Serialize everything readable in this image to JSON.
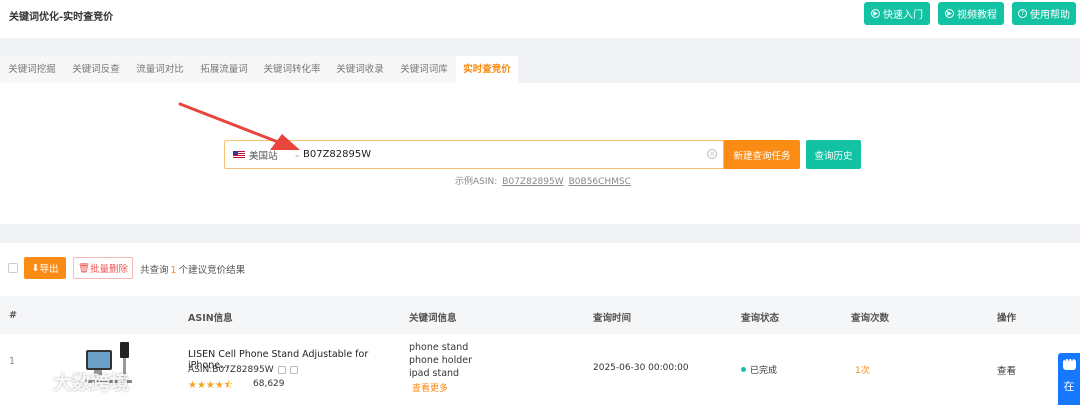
{
  "header": {
    "title": "关键词优化-实时查竞价",
    "buttons": [
      {
        "label": "快速入门",
        "icon": "play-circle-icon"
      },
      {
        "label": "视频教程",
        "icon": "play-circle-icon"
      },
      {
        "label": "使用帮助",
        "icon": "question-circle-icon"
      }
    ]
  },
  "tabs": [
    {
      "label": "关键词挖掘"
    },
    {
      "label": "关键词反查"
    },
    {
      "label": "流量词对比"
    },
    {
      "label": "拓展流量词"
    },
    {
      "label": "关键词转化率"
    },
    {
      "label": "关键词收录"
    },
    {
      "label": "关键词词库"
    },
    {
      "label": "实时查竞价",
      "active": true
    }
  ],
  "search": {
    "site": "美国站",
    "value": "B07Z82895W",
    "new_task_label": "新建查询任务",
    "history_label": "查询历史",
    "example_prefix": "示例ASIN:",
    "examples": [
      "B07Z82895W",
      "B0B56CHMSC"
    ]
  },
  "toolbar": {
    "export_label": "导出",
    "batch_delete_label": "批量删除",
    "count_prefix": "共查询",
    "count": "1",
    "count_suffix": "个建议竞价结果"
  },
  "table": {
    "columns": [
      "#",
      "ASIN信息",
      "关键词信息",
      "查询时间",
      "查询状态",
      "查询次数",
      "操作"
    ],
    "rows": [
      {
        "index": "1",
        "title": "LISEN Cell Phone Stand Adjustable for iPhone...",
        "asin": "ASIN:B07Z82895W",
        "rating": 4.5,
        "reviews": "68,629",
        "keywords": [
          "phone stand",
          "phone holder",
          "ipad stand"
        ],
        "more_label": "查看更多",
        "time": "2025-06-30 00:00:00",
        "status": "已完成",
        "times": "1次",
        "action": "查看"
      }
    ]
  },
  "chat": {
    "label": "在"
  },
  "watermark": {
    "text": "大数跨境"
  },
  "colors": {
    "accent_orange": "#fa8c16",
    "accent_teal": "#13c2a3",
    "chat_blue": "#1677ff"
  }
}
